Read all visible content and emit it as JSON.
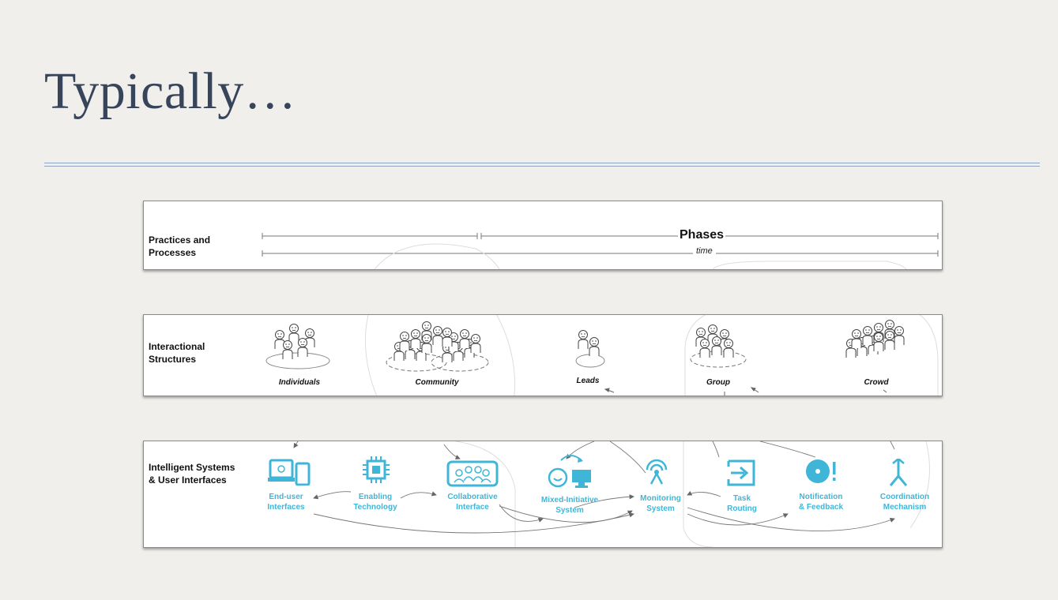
{
  "slide": {
    "title": "Typically…"
  },
  "colors": {
    "title": "#37445a",
    "rule": "#8fa3c0",
    "accent": "#3fb6d8"
  },
  "practices": {
    "label_line1": "Practices and",
    "label_line2": "Processes",
    "phases": "Phases",
    "time": "time"
  },
  "structures": {
    "label_line1": "Interactional",
    "label_line2": "Structures",
    "items": [
      {
        "label": "Individuals",
        "icon": "individuals-people-icon"
      },
      {
        "label": "Community",
        "icon": "community-people-icon"
      },
      {
        "label": "Leads",
        "icon": "leads-people-icon"
      },
      {
        "label": "Group",
        "icon": "group-people-icon"
      },
      {
        "label": "Crowd",
        "icon": "crowd-people-icon"
      }
    ]
  },
  "systems": {
    "label_line1": "Intelligent Systems",
    "label_line2": "& User Interfaces",
    "items": [
      {
        "line1": "End-user",
        "line2": "Interfaces",
        "icon": "devices-icon"
      },
      {
        "line1": "Enabling",
        "line2": "Technology",
        "icon": "chip-icon"
      },
      {
        "line1": "Collaborative",
        "line2": "Interface",
        "icon": "shared-screen-icon"
      },
      {
        "line1": "Mixed-Initiative",
        "line2": "System",
        "icon": "human-computer-icon"
      },
      {
        "line1": "Monitoring",
        "line2": "System",
        "icon": "antenna-icon"
      },
      {
        "line1": "Task",
        "line2": "Routing",
        "icon": "route-arrow-icon"
      },
      {
        "line1": "Notification",
        "line2": "& Feedback",
        "icon": "notification-icon"
      },
      {
        "line1": "Coordination",
        "line2": "Mechanism",
        "icon": "merge-arrow-icon"
      }
    ]
  }
}
